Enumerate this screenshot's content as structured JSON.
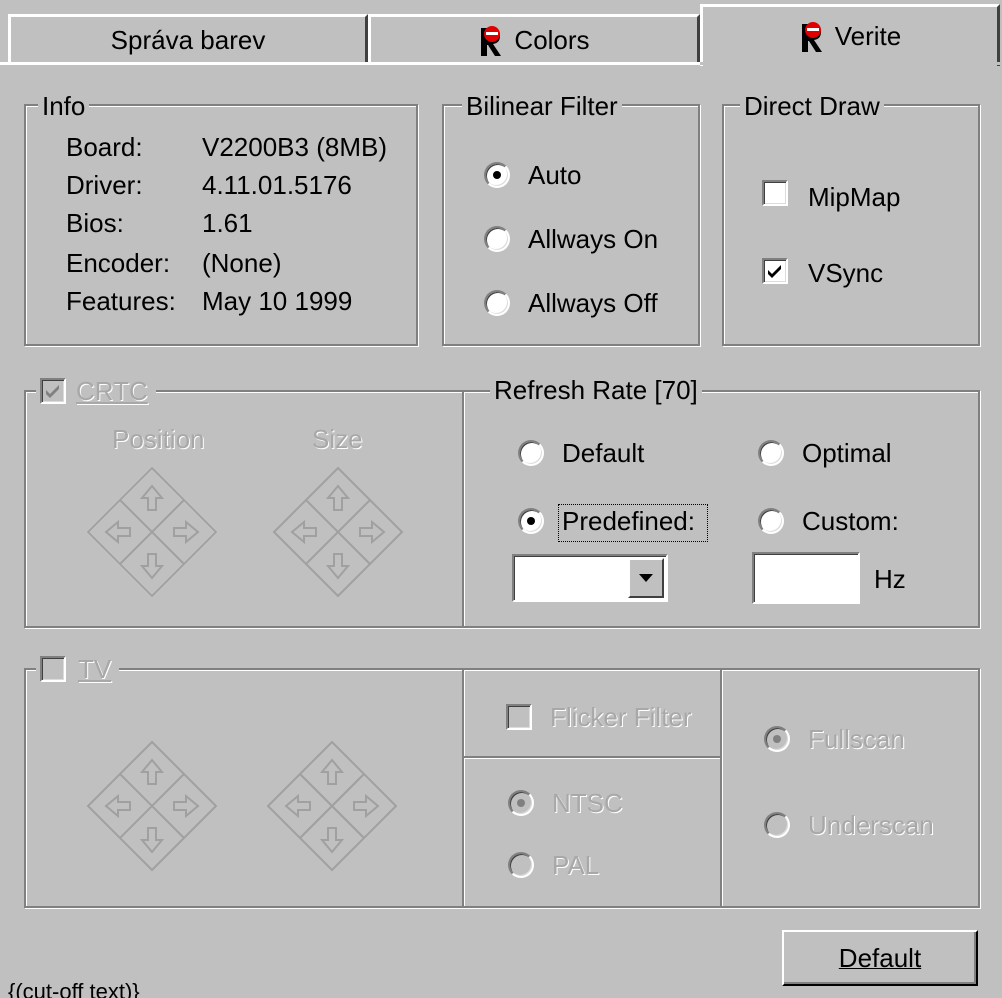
{
  "tabs": [
    {
      "label": "Správa barev"
    },
    {
      "label": "Colors",
      "icon": "r-logo-icon"
    },
    {
      "label": "Verite",
      "icon": "r-logo-icon"
    }
  ],
  "info": {
    "title": "Info",
    "rows": [
      {
        "label": "Board:",
        "value": "V2200B3 (8MB)"
      },
      {
        "label": "Driver:",
        "value": "4.11.01.5176"
      },
      {
        "label": "Bios:",
        "value": "1.61"
      },
      {
        "label": "Encoder:",
        "value": "(None)"
      },
      {
        "label": "Features:",
        "value": "May 10 1999"
      }
    ]
  },
  "bilinear": {
    "title": "Bilinear Filter",
    "options": [
      {
        "label": "Auto",
        "selected": true
      },
      {
        "label": "Allways On",
        "selected": false
      },
      {
        "label": "Allways Off",
        "selected": false
      }
    ]
  },
  "directdraw": {
    "title": "Direct Draw",
    "mipmap": {
      "label": "MipMap",
      "checked": false
    },
    "vsync": {
      "label": "VSync",
      "checked": true
    }
  },
  "crtc": {
    "label": "CRTC",
    "checked": true,
    "position_label": "Position",
    "size_label": "Size"
  },
  "refresh": {
    "title": "Refresh Rate [70]",
    "default_label": "Default",
    "optimal_label": "Optimal",
    "predefined_label": "Predefined:",
    "custom_label": "Custom:",
    "selected": "Predefined:",
    "predefined_value": "",
    "custom_value": "",
    "unit": "Hz"
  },
  "tv": {
    "label": "TV",
    "checked": false,
    "flicker_label": "Flicker Filter",
    "flicker_checked": false,
    "ntsc_label": "NTSC",
    "pal_label": "PAL",
    "standard_selected": "NTSC",
    "fullscan_label": "Fullscan",
    "underscan_label": "Underscan",
    "scan_selected": "Fullscan"
  },
  "default_button": {
    "label": "Default"
  },
  "footer_text": "{(cut-off text)}"
}
